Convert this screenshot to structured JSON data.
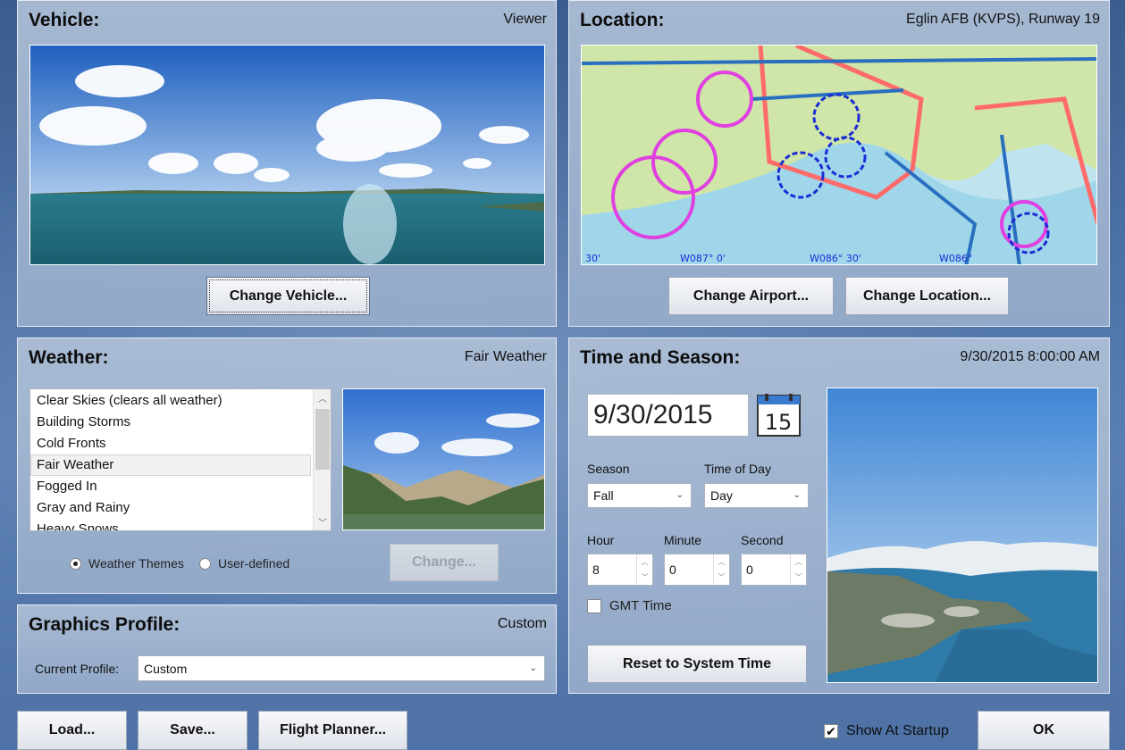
{
  "vehicle": {
    "title": "Vehicle:",
    "value": "Viewer",
    "change_button": "Change Vehicle..."
  },
  "location": {
    "title": "Location:",
    "value": "Eglin AFB (KVPS), Runway 19",
    "change_airport_button": "Change Airport...",
    "change_location_button": "Change Location...",
    "map_labels": [
      "W087° 0'",
      "W086° 30'",
      "W086°",
      "30'"
    ]
  },
  "weather": {
    "title": "Weather:",
    "value": "Fair Weather",
    "items": [
      "Clear Skies (clears all weather)",
      "Building Storms",
      "Cold Fronts",
      "Fair Weather",
      "Fogged In",
      "Gray and Rainy",
      "Heavy Snows"
    ],
    "selected_index": 3,
    "radio_themes": "Weather Themes",
    "radio_user": "User-defined",
    "change_button": "Change..."
  },
  "graphics": {
    "title": "Graphics Profile:",
    "value": "Custom",
    "current_label": "Current Profile:",
    "current_value": "Custom"
  },
  "time": {
    "title": "Time and Season:",
    "value": "9/30/2015 8:00:00 AM",
    "date": "9/30/2015",
    "calendar_day": "15",
    "season_label": "Season",
    "season_value": "Fall",
    "tod_label": "Time of Day",
    "tod_value": "Day",
    "hour_label": "Hour",
    "hour_value": "8",
    "minute_label": "Minute",
    "minute_value": "0",
    "second_label": "Second",
    "second_value": "0",
    "gmt_label": "GMT Time",
    "reset_button": "Reset to System Time"
  },
  "footer": {
    "load": "Load...",
    "save": "Save...",
    "planner": "Flight Planner...",
    "show_startup": "Show At Startup",
    "ok": "OK"
  }
}
